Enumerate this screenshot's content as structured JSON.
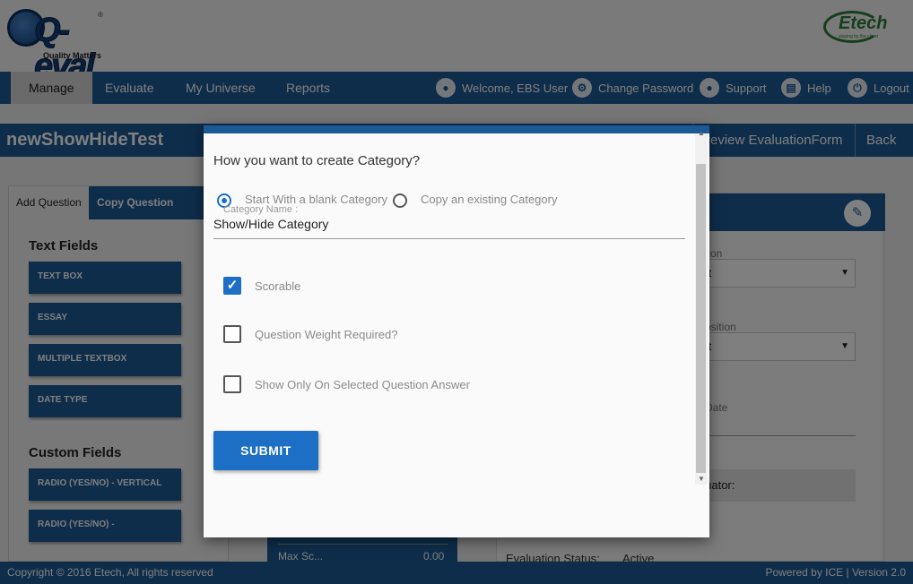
{
  "header": {
    "logo_text": "Q-eval",
    "logo_tagline": "Quality Matters",
    "logo_reg": "®",
    "etech_text": "Etech",
    "etech_tagline": "staying by the client"
  },
  "nav": {
    "tabs": [
      {
        "label": "Manage"
      },
      {
        "label": "Evaluate"
      },
      {
        "label": "My Universe"
      },
      {
        "label": "Reports"
      }
    ],
    "welcome": "Welcome, EBS User",
    "change_password": "Change Password",
    "support": "Support",
    "help": "Help",
    "logout": "Logout"
  },
  "titlebar": {
    "title": "newShowHideTest",
    "preview": "review EvaluationForm",
    "back": "Back"
  },
  "left_panel": {
    "tabs": [
      "Add Question",
      "Copy Question"
    ],
    "text_fields_heading": "Text Fields",
    "text_fields": [
      "TEXT BOX",
      "ESSAY",
      "MULTIPLE TEXTBOX",
      "DATE TYPE"
    ],
    "custom_fields_heading": "Custom Fields",
    "custom_fields": [
      "RADIO (YES/NO) - VERTICAL",
      "RADIO (YES/NO) -"
    ]
  },
  "right_panel": {
    "label1": "tion",
    "select1": "lect",
    "label2": "osition",
    "select2": "lect",
    "date_label": "Date",
    "evaluator": "aluator:",
    "status_label": "Evaluation Status:",
    "status_value": "Active"
  },
  "middle": {
    "text": "Max Sc...",
    "value": "0.00"
  },
  "modal": {
    "question": "How you want to create Category?",
    "option_blank": "Start With a blank Category",
    "option_copy": "Copy an existing Category",
    "category_label": "Category Name :",
    "category_value": "Show/Hide Category",
    "scorable": "Scorable",
    "scorable_checked": true,
    "weight_required": "Question Weight Required?",
    "show_only": "Show Only On Selected Question Answer",
    "submit": "SUBMIT"
  },
  "footer": {
    "copyright": "Copyright © 2016 Etech, All rights reserved",
    "powered": "Powered by ICE | Version 2.0"
  },
  "colors": {
    "primary": "#1c5a96",
    "accent": "#1c6fc4",
    "etech_green": "#2a7c39"
  }
}
